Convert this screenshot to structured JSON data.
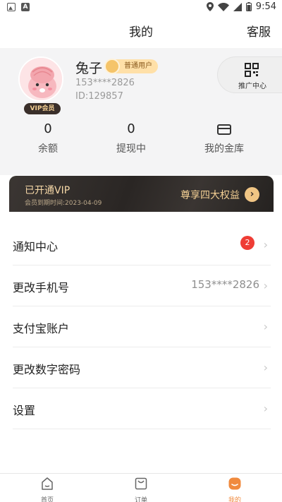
{
  "status_bar": {
    "time": "9:54"
  },
  "header": {
    "title": "我的",
    "service": "客服"
  },
  "profile": {
    "name": "兔子",
    "level": "普通用户",
    "phone": "153****2826",
    "id_text": "ID:129857",
    "vip_tag": "VIP会员",
    "promo_label": "推广中心"
  },
  "stats": [
    {
      "value": "0",
      "label": "余额"
    },
    {
      "value": "0",
      "label": "提现中"
    },
    {
      "value": "",
      "label": "我的金库"
    }
  ],
  "vip_banner": {
    "title": "已开通VIP",
    "expiry": "会员到期时间:2023-04-09",
    "benefit": "尊享四大权益"
  },
  "menu": {
    "items": [
      {
        "label": "通知中心",
        "badge": "2"
      },
      {
        "label": "更改手机号",
        "value": "153****2826"
      },
      {
        "label": "支付宝账户"
      },
      {
        "label": "更改数字密码"
      },
      {
        "label": "设置"
      }
    ]
  },
  "bottom_nav": {
    "items": [
      {
        "label": "首页"
      },
      {
        "label": "订单"
      },
      {
        "label": "我的"
      }
    ],
    "active_color": "#f08a3e"
  },
  "colors": {
    "badge": "#ef3d35",
    "vip_gold": "#f3cf94"
  }
}
